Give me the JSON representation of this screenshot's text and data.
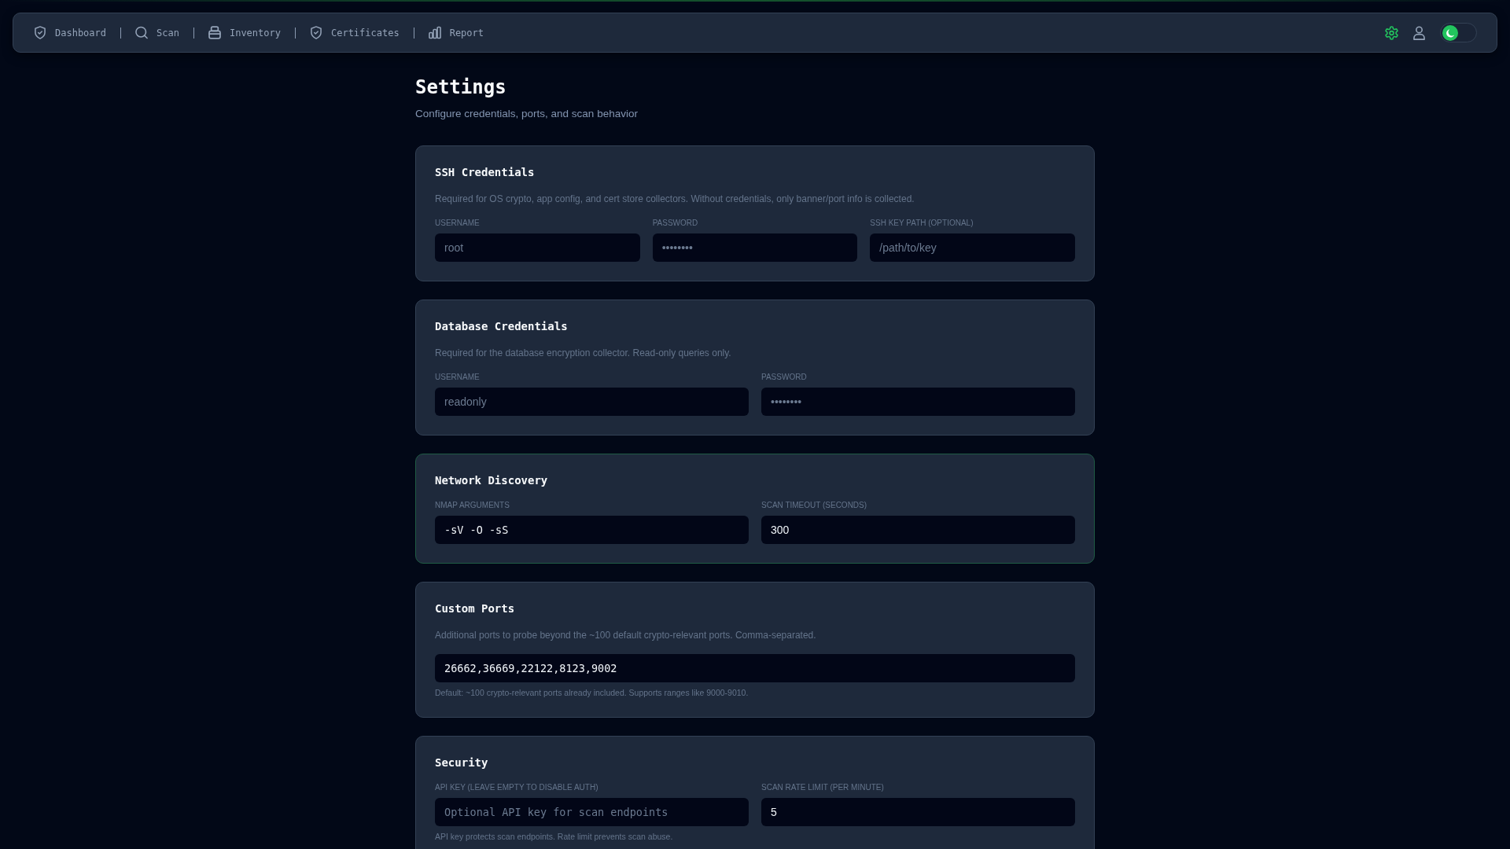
{
  "nav": {
    "items": [
      {
        "label": "Dashboard",
        "selected": false
      },
      {
        "label": "Scan",
        "selected": false
      },
      {
        "label": "Inventory",
        "selected": false
      },
      {
        "label": "Certificates",
        "selected": false
      },
      {
        "label": "Report",
        "selected": false
      }
    ],
    "actions": [
      {
        "selected": true
      },
      {
        "selected": false
      }
    ],
    "theme_toggle": {
      "light_mode": false
    }
  },
  "page": {
    "title": "Settings",
    "subtitle": "Configure credentials, ports, and scan behavior"
  },
  "sections": [
    {
      "title": "SSH Credentials",
      "highlighted": false,
      "description": "Required for OS crypto, app config, and cert store collectors. Without credentials, only banner/port info is collected.",
      "fields": [
        {
          "label": "USERNAME",
          "kind": "text",
          "placeholder": "root"
        },
        {
          "label": "PASSWORD",
          "kind": "password",
          "placeholder": "••••••••"
        },
        {
          "label": "SSH KEY PATH (OPTIONAL)",
          "kind": "text",
          "placeholder": "/path/to/key"
        }
      ]
    },
    {
      "title": "Database Credentials",
      "highlighted": false,
      "description": "Required for the database encryption collector. Read-only queries only.",
      "fields": [
        {
          "label": "USERNAME",
          "kind": "text",
          "placeholder": "readonly"
        },
        {
          "label": "PASSWORD",
          "kind": "password",
          "placeholder": "••••••••"
        }
      ]
    },
    {
      "title": "Network Discovery",
      "highlighted": true,
      "fields": [
        {
          "label": "NMAP ARGUMENTS",
          "kind": "code",
          "value": "-sV -O -sS"
        },
        {
          "label": "SCAN TIMEOUT (SECONDS)",
          "kind": "text",
          "value": "300"
        }
      ]
    },
    {
      "title": "Custom Ports",
      "highlighted": false,
      "description": "Additional ports to probe beyond the ~100 default crypto-relevant ports. Comma-separated.",
      "fields": [
        {
          "kind": "code",
          "value": "26662,36669,22122,8123,9002"
        }
      ],
      "hint": "Default: ~100 crypto-relevant ports already included. Supports ranges like 9000-9010."
    },
    {
      "title": "Security",
      "highlighted": false,
      "fields": [
        {
          "label": "API KEY (LEAVE EMPTY TO DISABLE AUTH)",
          "kind": "code",
          "placeholder": "Optional API key for scan endpoints"
        },
        {
          "label": "SCAN RATE LIMIT (PER MINUTE)",
          "kind": "text",
          "value": "5"
        }
      ],
      "hint": "API key protects scan endpoints. Rate limit prevents scan abuse."
    }
  ]
}
